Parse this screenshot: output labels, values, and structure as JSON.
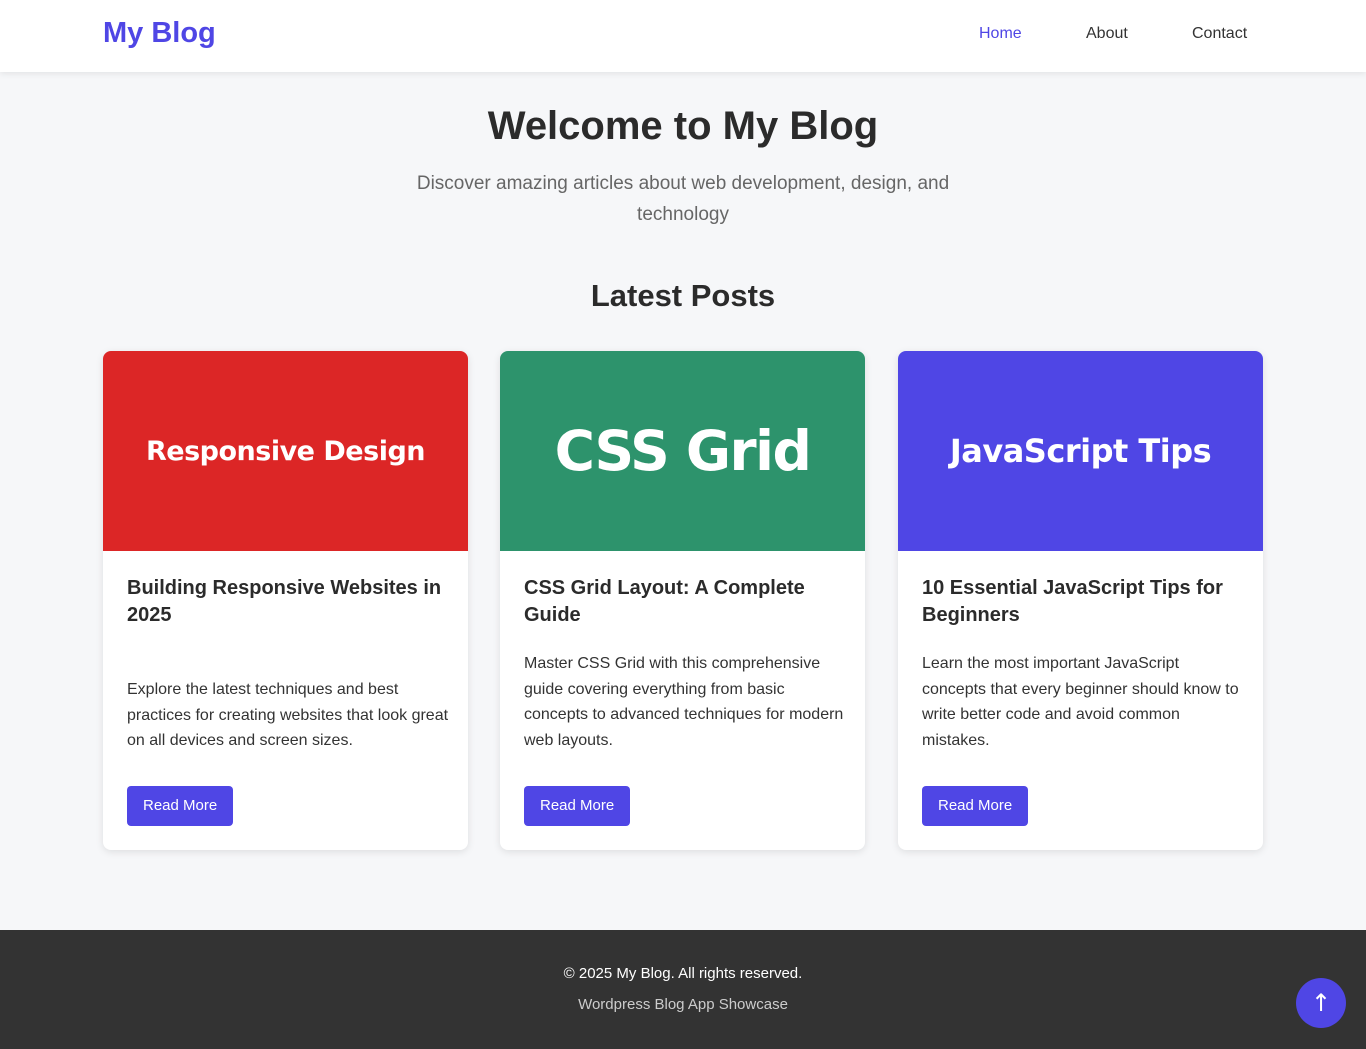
{
  "header": {
    "logo": "My Blog",
    "nav": [
      {
        "label": "Home",
        "active": true
      },
      {
        "label": "About",
        "active": false
      },
      {
        "label": "Contact",
        "active": false
      }
    ]
  },
  "hero": {
    "title": "Welcome to My Blog",
    "subtitle": "Discover amazing articles about web development, design, and technology"
  },
  "posts_section": {
    "title": "Latest Posts",
    "posts": [
      {
        "image_text": "Responsive Design",
        "image_color": "#dc2626",
        "title": "Building Responsive Websites in 2025",
        "excerpt": "Explore the latest techniques and best practices for creating websites that look great on all devices and screen sizes.",
        "button": "Read More"
      },
      {
        "image_text": "CSS Grid",
        "image_color": "#2d936c",
        "title": "CSS Grid Layout: A Complete Guide",
        "excerpt": "Master CSS Grid with this comprehensive guide covering everything from basic concepts to advanced techniques for modern web layouts.",
        "button": "Read More"
      },
      {
        "image_text": "JavaScript Tips",
        "image_color": "#4f46e5",
        "title": "10 Essential JavaScript Tips for Beginners",
        "excerpt": "Learn the most important JavaScript concepts that every beginner should know to write better code and avoid common mistakes.",
        "button": "Read More"
      }
    ]
  },
  "footer": {
    "copyright": "© 2025 My Blog. All rights reserved.",
    "tagline": "Wordpress Blog App Showcase"
  },
  "back_to_top": {
    "icon": "arrow-up-icon",
    "glyph": "↑"
  },
  "colors": {
    "accent": "#4f46e5",
    "footer_bg": "#333333",
    "page_bg": "#f6f7f9"
  }
}
